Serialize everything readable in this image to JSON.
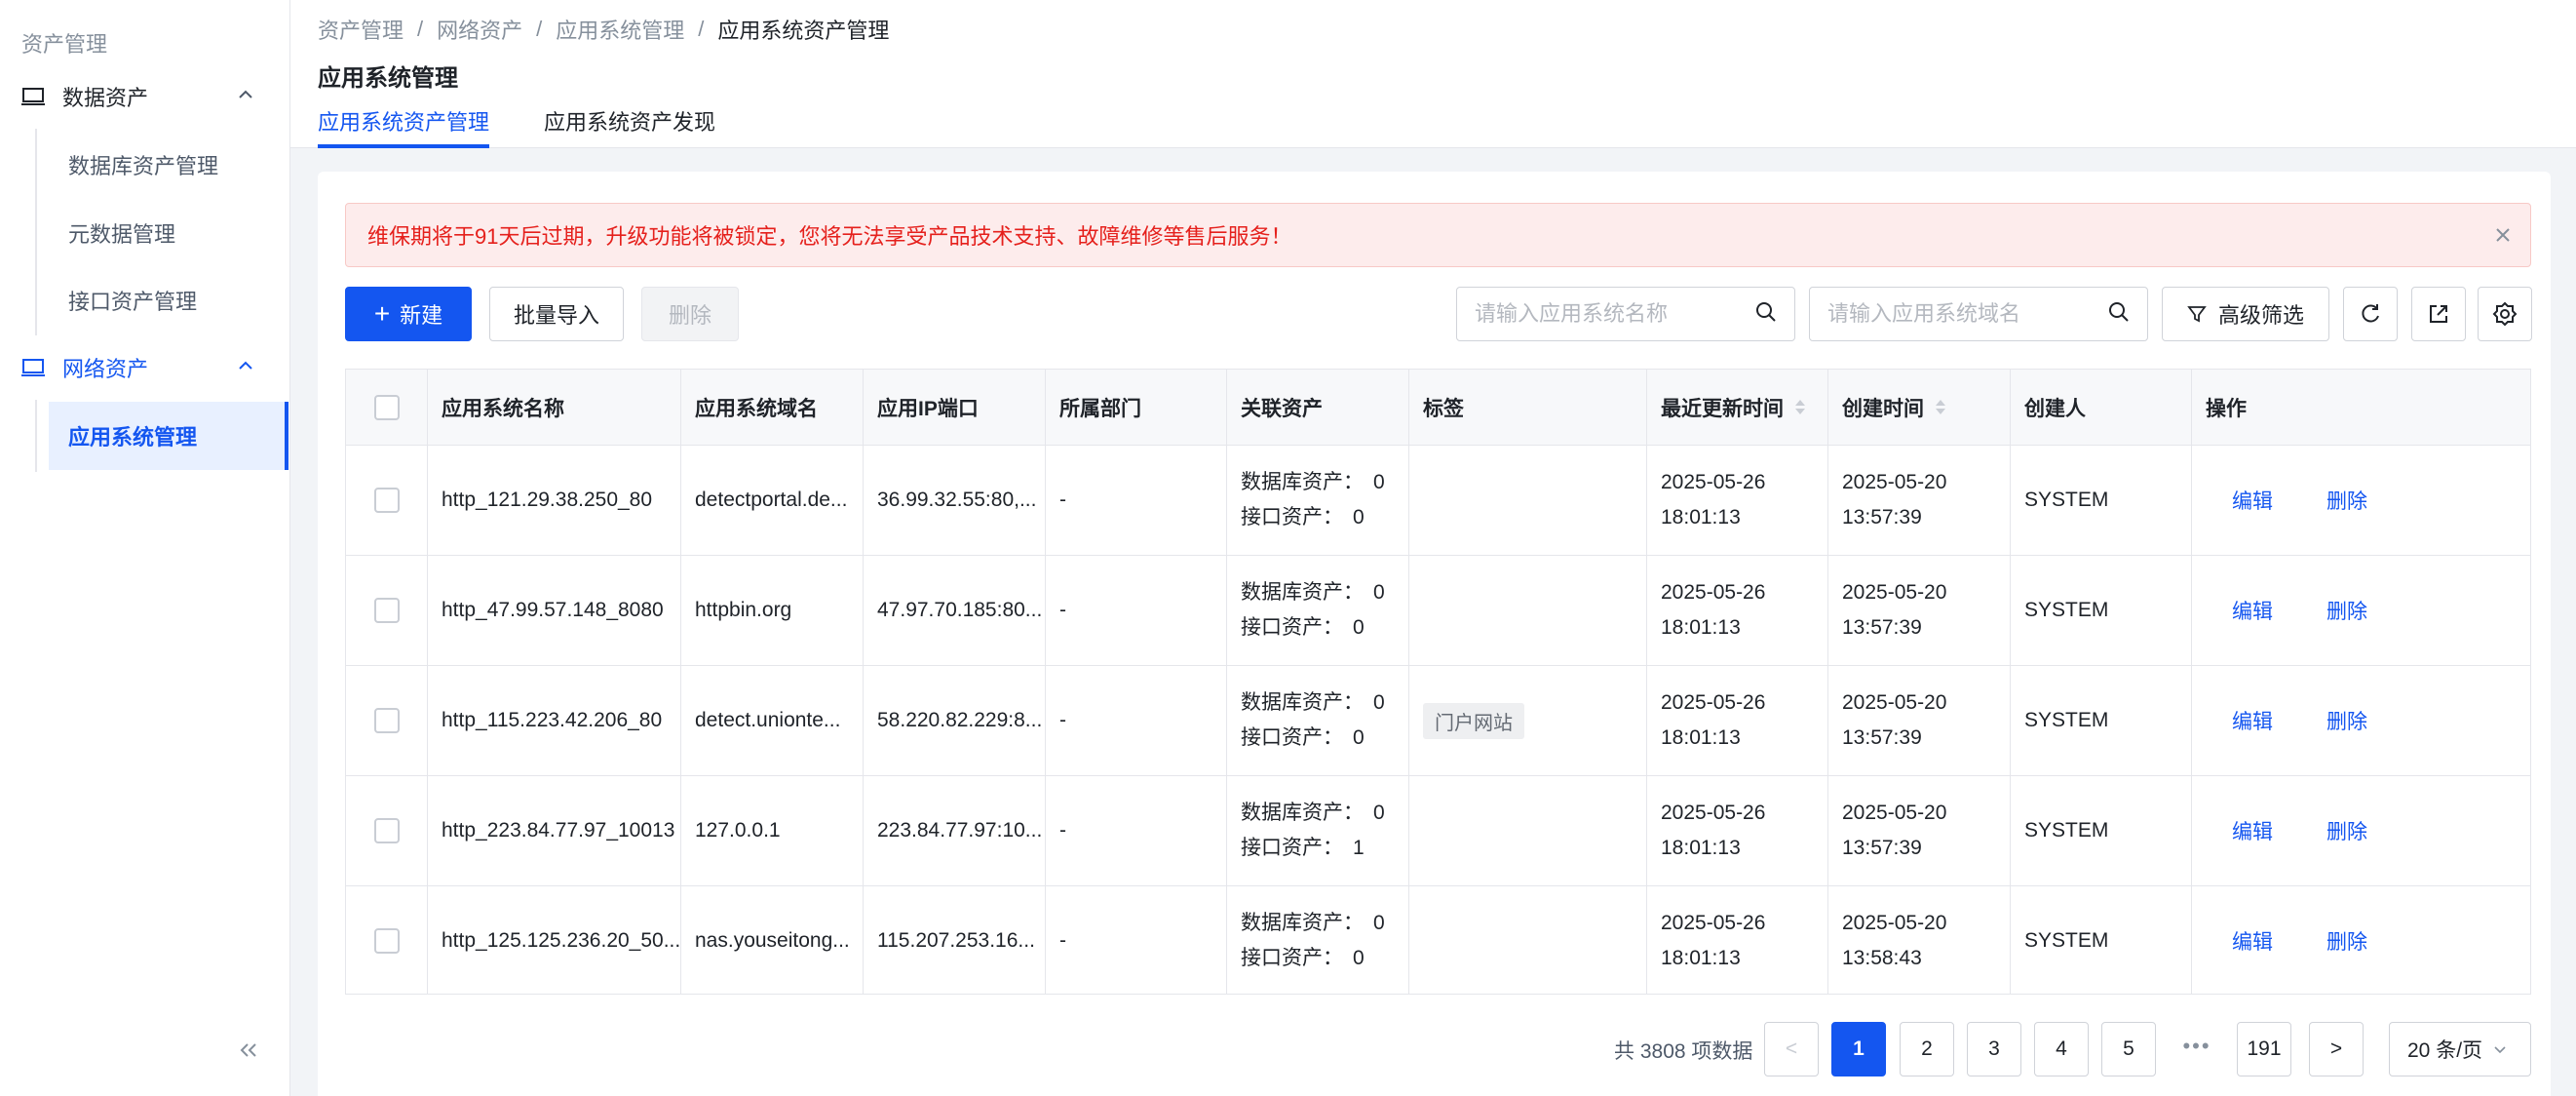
{
  "sidebar": {
    "section_title": "资产管理",
    "groups": [
      {
        "label": "数据资产",
        "items": [
          "数据库资产管理",
          "元数据管理",
          "接口资产管理"
        ]
      },
      {
        "label": "网络资产",
        "items": [
          "应用系统管理"
        ]
      }
    ],
    "collapse_glyph": "«"
  },
  "breadcrumb": [
    "资产管理",
    "网络资产",
    "应用系统管理",
    "应用系统资产管理"
  ],
  "page_title": "应用系统管理",
  "tabs": [
    "应用系统资产管理",
    "应用系统资产发现"
  ],
  "alert": "维保期将于91天后过期，升级功能将被锁定，您将无法享受产品技术支持、故障维修等售后服务！",
  "toolbar": {
    "new_label": "新建",
    "import_label": "批量导入",
    "delete_label": "删除",
    "search_name_placeholder": "请输入应用系统名称",
    "search_domain_placeholder": "请输入应用系统域名",
    "filter_label": "高级筛选"
  },
  "table": {
    "headers": [
      "应用系统名称",
      "应用系统域名",
      "应用IP端口",
      "所属部门",
      "关联资产",
      "标签",
      "最近更新时间",
      "创建时间",
      "创建人",
      "操作"
    ],
    "asset_labels": {
      "db": "数据库资产：",
      "api": "接口资产："
    },
    "actions": {
      "edit": "编辑",
      "delete": "删除"
    },
    "rows": [
      {
        "name": "http_121.29.38.250_80",
        "domain": "detectportal.de...",
        "ip": "36.99.32.55:80,...",
        "dept": "-",
        "db": "0",
        "api": "0",
        "tag": "",
        "updated_date": "2025-05-26",
        "updated_time": "18:01:13",
        "created_date": "2025-05-20",
        "created_time": "13:57:39",
        "creator": "SYSTEM"
      },
      {
        "name": "http_47.99.57.148_8080",
        "domain": "httpbin.org",
        "ip": "47.97.70.185:80...",
        "dept": "-",
        "db": "0",
        "api": "0",
        "tag": "",
        "updated_date": "2025-05-26",
        "updated_time": "18:01:13",
        "created_date": "2025-05-20",
        "created_time": "13:57:39",
        "creator": "SYSTEM"
      },
      {
        "name": "http_115.223.42.206_80",
        "domain": "detect.unionte...",
        "ip": "58.220.82.229:8...",
        "dept": "-",
        "db": "0",
        "api": "0",
        "tag": "门户网站",
        "updated_date": "2025-05-26",
        "updated_time": "18:01:13",
        "created_date": "2025-05-20",
        "created_time": "13:57:39",
        "creator": "SYSTEM"
      },
      {
        "name": "http_223.84.77.97_10013",
        "domain": "127.0.0.1",
        "ip": "223.84.77.97:10...",
        "dept": "-",
        "db": "0",
        "api": "1",
        "tag": "",
        "updated_date": "2025-05-26",
        "updated_time": "18:01:13",
        "created_date": "2025-05-20",
        "created_time": "13:57:39",
        "creator": "SYSTEM"
      },
      {
        "name": "http_125.125.236.20_50...",
        "domain": "nas.youseitong...",
        "ip": "115.207.253.16...",
        "dept": "-",
        "db": "0",
        "api": "0",
        "tag": "",
        "updated_date": "2025-05-26",
        "updated_time": "18:01:13",
        "created_date": "2025-05-20",
        "created_time": "13:58:43",
        "creator": "SYSTEM"
      }
    ]
  },
  "pagination": {
    "total_text": "共 3808 项数据",
    "pages": [
      "1",
      "2",
      "3",
      "4",
      "5"
    ],
    "last_page": "191",
    "current": "1",
    "ellipsis": "•••",
    "page_size": "20 条/页",
    "prev_glyph": "<",
    "next_glyph": ">"
  },
  "colors": {
    "accent": "#1456f0",
    "alert_text": "#e5201c",
    "alert_bg": "#fdecec"
  }
}
